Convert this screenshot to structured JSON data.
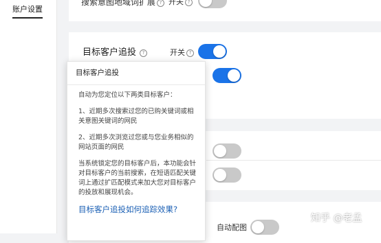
{
  "sidebar": {
    "items": [
      {
        "label": "账户设置",
        "active": true
      }
    ]
  },
  "search_intent_expand": {
    "label": "搜索意图地域词扩展",
    "switch_label": "开关",
    "enabled": false
  },
  "target_customer": {
    "title": "目标客户追投",
    "switch_label": "开关",
    "enabled": true
  },
  "second_toggle": {
    "enabled": true
  },
  "middle_toggles": [
    {
      "enabled": false
    },
    {
      "enabled": false
    }
  ],
  "auto_image": {
    "label": "自动配图",
    "enabled": false
  },
  "popover": {
    "title": "目标客户追投",
    "intro": "自动为您定位以下两类目标客户：",
    "point1": "1、近期多次搜索过您的已购关键词或相关意图关键词的网民",
    "point2": "2、近期多次浏览过您或与您业务相似的网站页面的网民",
    "description": "当系统锁定您的目标客户后，本功能会针对目标客户的当前搜索，在短语匹配关键词上通过扩匹配模式来加大您对目标客户的投放和展现机会。",
    "link": "目标客户追投如何追踪效果?"
  },
  "watermark": "知乎 @老孟",
  "colors": {
    "toggle_on": "#1a73e8",
    "toggle_off": "#c9c9c9",
    "link": "#1a5fb4"
  }
}
